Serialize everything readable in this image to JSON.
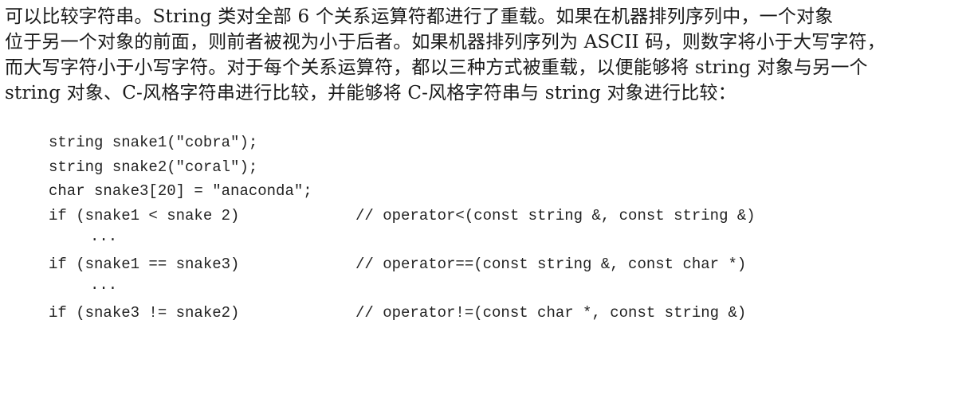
{
  "paragraph": {
    "lines": [
      "    可以比较字符串。String 类对全部 6 个关系运算符都进行了重载。如果在机器排列序列中，一个对象",
      "位于另一个对象的前面，则前者被视为小于后者。如果机器排列序列为 ASCII 码，则数字将小于大写字符，",
      "而大写字符小于小写字符。对于每个关系运算符，都以三种方式被重载，以便能够将 string 对象与另一个",
      "string 对象、C-风格字符串进行比较，并能够将 C-风格字符串与 string 对象进行比较："
    ]
  },
  "code": {
    "lines": [
      {
        "stmt": "string snake1(\"cobra\");",
        "comment": ""
      },
      {
        "stmt": "string snake2(\"coral\");",
        "comment": ""
      },
      {
        "stmt": "char snake3[20] = \"anaconda\";",
        "comment": ""
      },
      {
        "stmt": "if (snake1 < snake 2)",
        "comment": "// operator<(const string &, const string &)"
      },
      {
        "stmt": "",
        "dots": "...",
        "comment": ""
      },
      {
        "stmt": "if (snake1 == snake3)",
        "comment": "// operator==(const string &, const char *)"
      },
      {
        "stmt": "",
        "dots": "...",
        "comment": ""
      },
      {
        "stmt": "if (snake3 != snake2)",
        "comment": "// operator!=(const char *, const string &)"
      }
    ]
  }
}
